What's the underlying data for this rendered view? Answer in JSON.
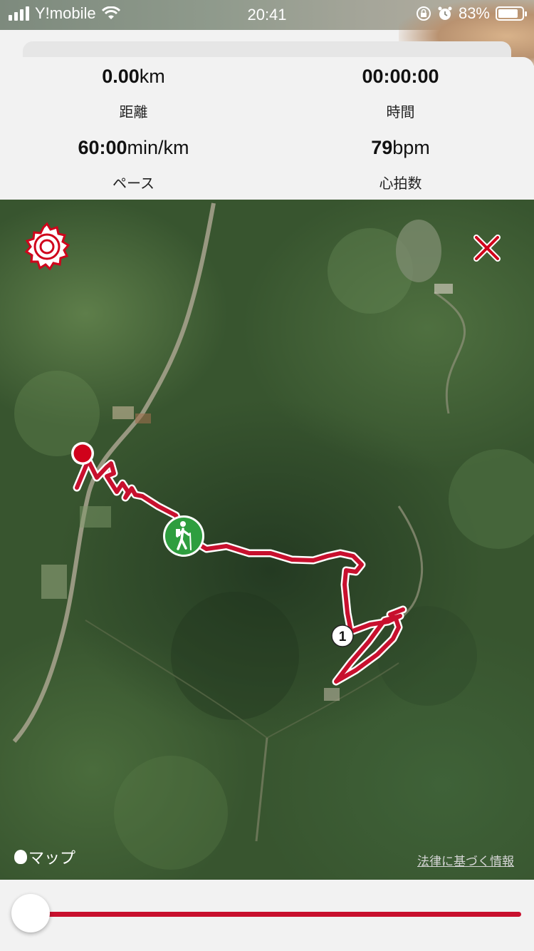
{
  "status_bar": {
    "carrier": "Y!mobile",
    "time": "20:41",
    "battery": "83%",
    "battery_level": 0.83
  },
  "stats": {
    "distance": {
      "value": "0.00",
      "unit": "km",
      "label": "距離"
    },
    "time": {
      "value": "00:00:00",
      "unit": "",
      "label": "時間"
    },
    "pace": {
      "value": "60:00",
      "unit": "min/km",
      "label": "ペース"
    },
    "heart_rate": {
      "value": "79",
      "unit": "bpm",
      "label": "心拍数"
    }
  },
  "map": {
    "attribution": "マップ",
    "legal_link": "法律に基づく情報",
    "waypoint_label": "1",
    "route_color": "#c8102e",
    "hiker_marker_color": "#2e9e3f"
  },
  "playback": {
    "progress": 0.0,
    "track_color": "#c8102e"
  }
}
